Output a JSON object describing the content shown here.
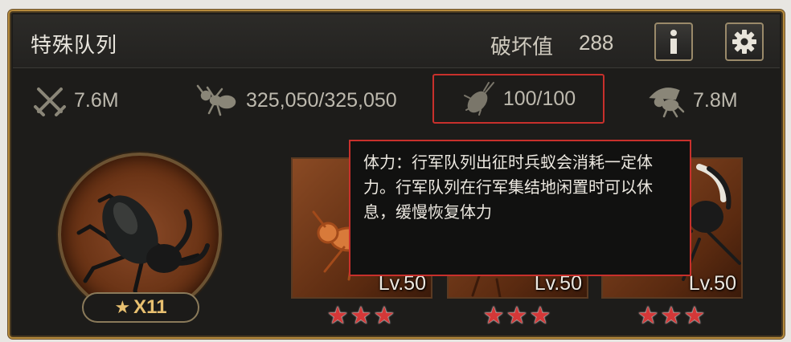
{
  "header": {
    "title": "特殊队列",
    "destroy_label": "破坏值",
    "destroy_value": "288",
    "info_icon": "info-icon",
    "settings_icon": "gear-icon"
  },
  "stats": {
    "power": {
      "icon": "crossed-swords-icon",
      "value": "7.6M"
    },
    "troops": {
      "icon": "ant-icon",
      "value": "325,050/325,050"
    },
    "stamina": {
      "icon": "cockroach-icon",
      "value": "100/100"
    },
    "load": {
      "icon": "carrying-ant-icon",
      "value": "7.8M"
    }
  },
  "hero": {
    "icon": "beetle-icon",
    "star_icon": "★",
    "count": "X11"
  },
  "units": [
    {
      "level": "Lv.50",
      "stars": "★★★",
      "rating": 3
    },
    {
      "level": "Lv.50",
      "stars": "★★★",
      "rating": 3
    },
    {
      "level": "Lv.50",
      "stars": "★★★",
      "rating": 3
    }
  ],
  "tooltip": {
    "text": "体力：行军队列出征时兵蚁会消耗一定体力。行军队列在行军集结地闲置时可以休息，缓慢恢复体力"
  },
  "colors": {
    "frame": "#b58a3c",
    "highlight": "#c8302c",
    "panel": "#1d1c1a",
    "star": "#d43838"
  }
}
